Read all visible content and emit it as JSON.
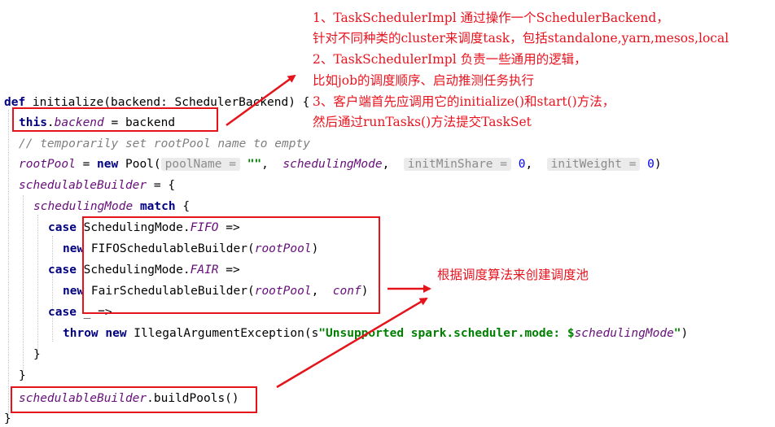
{
  "code": {
    "line1_def": "def",
    "line1_rest": " initialize(backend: SchedulerBackend) {",
    "line2_this": "this",
    "line2_dot": ".",
    "line2_field": "backend",
    "line2_rest": " = backend",
    "line3_comment": "// temporarily set rootPool name to empty",
    "line4_field": "rootPool",
    "line4_eq": " = ",
    "line4_new": "new",
    "line4_cls": " Pool(",
    "hint_poolName": "poolName =",
    "line4_str": "\"\"",
    "line4_comma1": ",",
    "line4_schedmode": "schedulingMode",
    "line4_comma2": ",",
    "hint_minShare": "initMinShare =",
    "line4_zero1": "0",
    "line4_comma3": ",",
    "hint_weight": "initWeight =",
    "line4_zero2": "0",
    "line4_close": ")",
    "line5_field": "schedulableBuilder",
    "line5_rest": " = {",
    "line6_field": "schedulingMode",
    "line6_match": "match",
    "line6_brace": " {",
    "line7_case": "case",
    "line7_rest": " SchedulingMode.",
    "line7_const": "FIFO",
    "line7_arrow": " =>",
    "line8_new": "new",
    "line8_cls": " FIFOSchedulableBuilder(",
    "line8_arg": "rootPool",
    "line8_close": ")",
    "line9_case": "case",
    "line9_rest": " SchedulingMode.",
    "line9_const": "FAIR",
    "line9_arrow": " =>",
    "line10_new": "new",
    "line10_cls": " FairSchedulableBuilder(",
    "line10_arg1": "rootPool",
    "line10_comma": ",  ",
    "line10_arg2": "conf",
    "line10_close": ")",
    "line11_case": "case",
    "line11_rest": " _ =>",
    "line12_throw": "throw",
    "line12_new": " new",
    "line12_cls": " IllegalArgumentException(",
    "line12_s": "s",
    "line12_str": "\"Unsupported spark.scheduler.mode: ",
    "line12_dollar": "$",
    "line12_var": "schedulingMode",
    "line12_strend": "\"",
    "line12_close": ")",
    "line13_brace": "}",
    "line14_brace": "}",
    "line15_field": "schedulableBuilder",
    "line15_rest": ".buildPools()",
    "line16_brace": "}"
  },
  "annotations": {
    "top_1": "1、TaskSchedulerImpl 通过操作一个SchedulerBackend，",
    "top_2": "针对不同种类的cluster来调度task，包括standalone,yarn,mesos,local",
    "top_3": "2、TaskSchedulerImpl 负责一些通用的逻辑，",
    "top_4": "比如job的调度顺序、启动推测任务执行",
    "top_5": "3、客户端首先应调用它的initialize()和start()方法，",
    "top_6": "然后通过runTasks()方法提交TaskSet",
    "right_1": "根据调度算法来创建调度池"
  },
  "colors": {
    "annotation_red": "#e8131e",
    "keyword": "#000080",
    "field": "#660e7a",
    "comment": "#808080",
    "string": "#008000",
    "number": "#0000ff"
  }
}
